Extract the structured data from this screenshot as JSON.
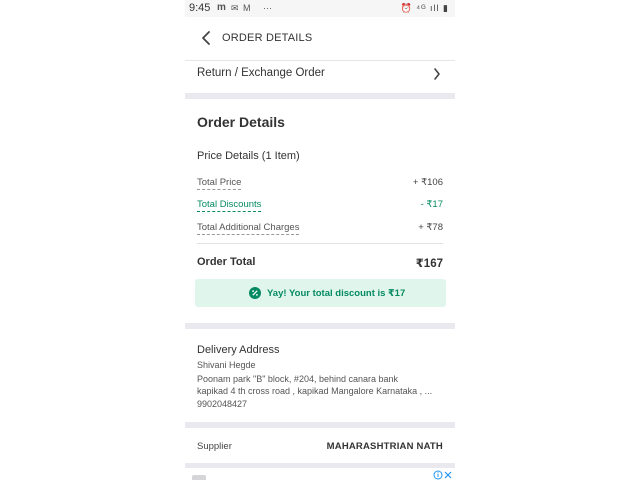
{
  "status_bar": {
    "time": "9:45",
    "left_icons": [
      "m-app-icon",
      "mail-icon",
      "gmail-icon"
    ],
    "more": "···",
    "right": "⏰ ⁴ᴳ ıll ▮"
  },
  "header": {
    "title": "ORDER DETAILS"
  },
  "return_row": {
    "label": "Return / Exchange Order"
  },
  "order_details": {
    "title": "Order Details",
    "price_details_title": "Price Details (1 Item)",
    "rows": [
      {
        "label": "Total Price",
        "value": "+  ₹106"
      },
      {
        "label": "Total Discounts",
        "value": "-  ₹17"
      },
      {
        "label": "Total Additional Charges",
        "value": "+  ₹78"
      }
    ],
    "total_label": "Order Total",
    "total_value": "₹167",
    "banner_text": "Yay! Your total discount is ₹17"
  },
  "delivery": {
    "title": "Delivery Address",
    "name": "Shivani Hegde",
    "line1": "Poonam park \"B\" block, #204, behind canara bank",
    "line2": "kapikad 4 th cross road , kapikad Mangalore Karnataka , ...",
    "phone": "9902048427"
  },
  "supplier": {
    "label": "Supplier",
    "name": "MAHARASHTRIAN NATH"
  },
  "colors": {
    "accent_green": "#068a62",
    "banner_bg": "#e0f5ec",
    "separator": "#e9e9ef"
  }
}
